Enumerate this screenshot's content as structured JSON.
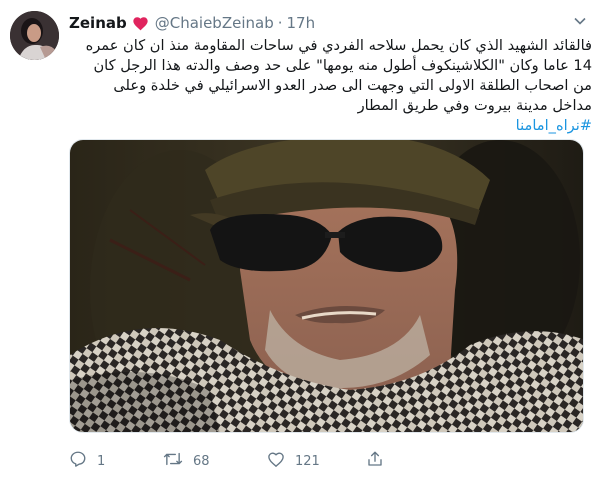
{
  "tweet": {
    "name": "Zeinab",
    "handle": "@ChaiebZeinab",
    "separator": "·",
    "time": "17h",
    "text_lines": [
      "فالقائد الشهيد الذي كان يحمل سلاحه الفردي في ساحات المقاومة منذ ان كان عمره",
      "14 عاما وكان \"الكلاشينكوف أطول منه يومها\" على حد وصف والدته هذا الرجل كان",
      "من اصحاب الطلقة الاولى التي وجهت الى صدر العدو الاسرائيلي في خلدة وعلى",
      "مداخل مدينة بيروت وفي طريق المطار"
    ],
    "hashtag": "#نراه_امامنا"
  },
  "actions": {
    "reply_count": "1",
    "retweet_count": "68",
    "like_count": "121"
  },
  "icons": {
    "verified_like": "red-heart-icon",
    "caret": "chevron-down-icon",
    "reply": "reply-icon",
    "retweet": "retweet-icon",
    "like": "like-heart-icon",
    "share": "share-icon"
  },
  "colors": {
    "text": "#14171a",
    "secondary": "#657786",
    "link": "#1b95e0",
    "heart": "#e0245e"
  }
}
